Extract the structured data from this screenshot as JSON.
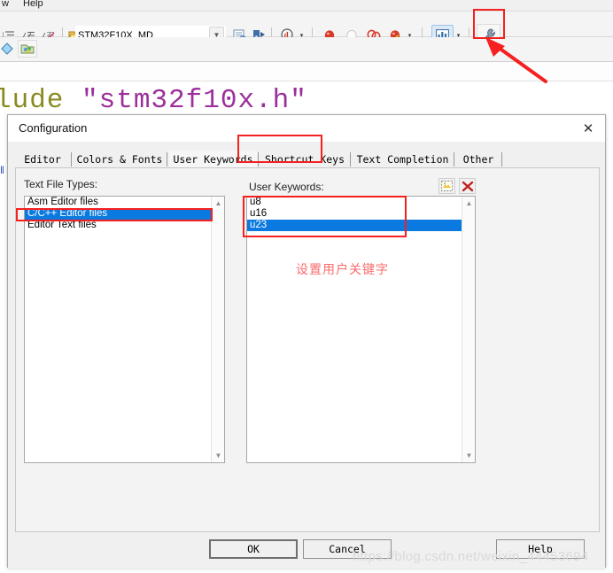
{
  "ide": {
    "menu": {
      "window": "w",
      "help": "Help"
    },
    "target_dropdown": {
      "value": "STM32F10X_MD",
      "arrow": "chevron-down-icon"
    },
    "toolbar_icons": [
      "indent-icon",
      "comment-icon",
      "uncomment-icon",
      "open-project-icon",
      "file-info-icon",
      "bookmark-icon",
      "find-in-files-icon",
      "breakpoint-icon",
      "breakpoint-disable-icon",
      "breakpoint-all-icon",
      "breakpoint-kill-icon",
      "window-layout-icon",
      "configuration-wrench-icon"
    ],
    "code_line": {
      "keyword": "lude ",
      "string": "\"stm32f10x.h\""
    }
  },
  "annotations": {
    "chinese_note": "设置用户关键字",
    "watermark": "https://blog.csdn.net/weixin_44453694"
  },
  "dialog": {
    "title": "Configuration",
    "close_label": "✕",
    "tabs": [
      {
        "label": "Editor",
        "active": false
      },
      {
        "label": "Colors & Fonts",
        "active": false
      },
      {
        "label": "User Keywords",
        "active": true
      },
      {
        "label": "Shortcut Keys",
        "active": false
      },
      {
        "label": "Text Completion",
        "active": false
      },
      {
        "label": "Other",
        "active": false
      }
    ],
    "left_panel": {
      "label": "Text File Types:",
      "items": [
        {
          "text": "Asm Editor files",
          "selected": false
        },
        {
          "text": "C/C++ Editor files",
          "selected": true
        },
        {
          "text": "Editor Text files",
          "selected": false
        }
      ]
    },
    "right_panel": {
      "label": "User Keywords:",
      "new_button": "new-keyword-icon",
      "delete_button": "delete-keyword-icon",
      "items": [
        {
          "text": "u8",
          "selected": false
        },
        {
          "text": "u16",
          "selected": false
        },
        {
          "text": "u23",
          "selected": true
        }
      ]
    },
    "buttons": {
      "ok": "OK",
      "cancel": "Cancel",
      "help": "Help"
    }
  },
  "colors": {
    "selection_blue": "#0a7ae0",
    "annotation_red": "#f52020",
    "note_red": "#fb6b6b",
    "code_keyword": "#8a8a23",
    "code_string": "#9b2f9b"
  }
}
